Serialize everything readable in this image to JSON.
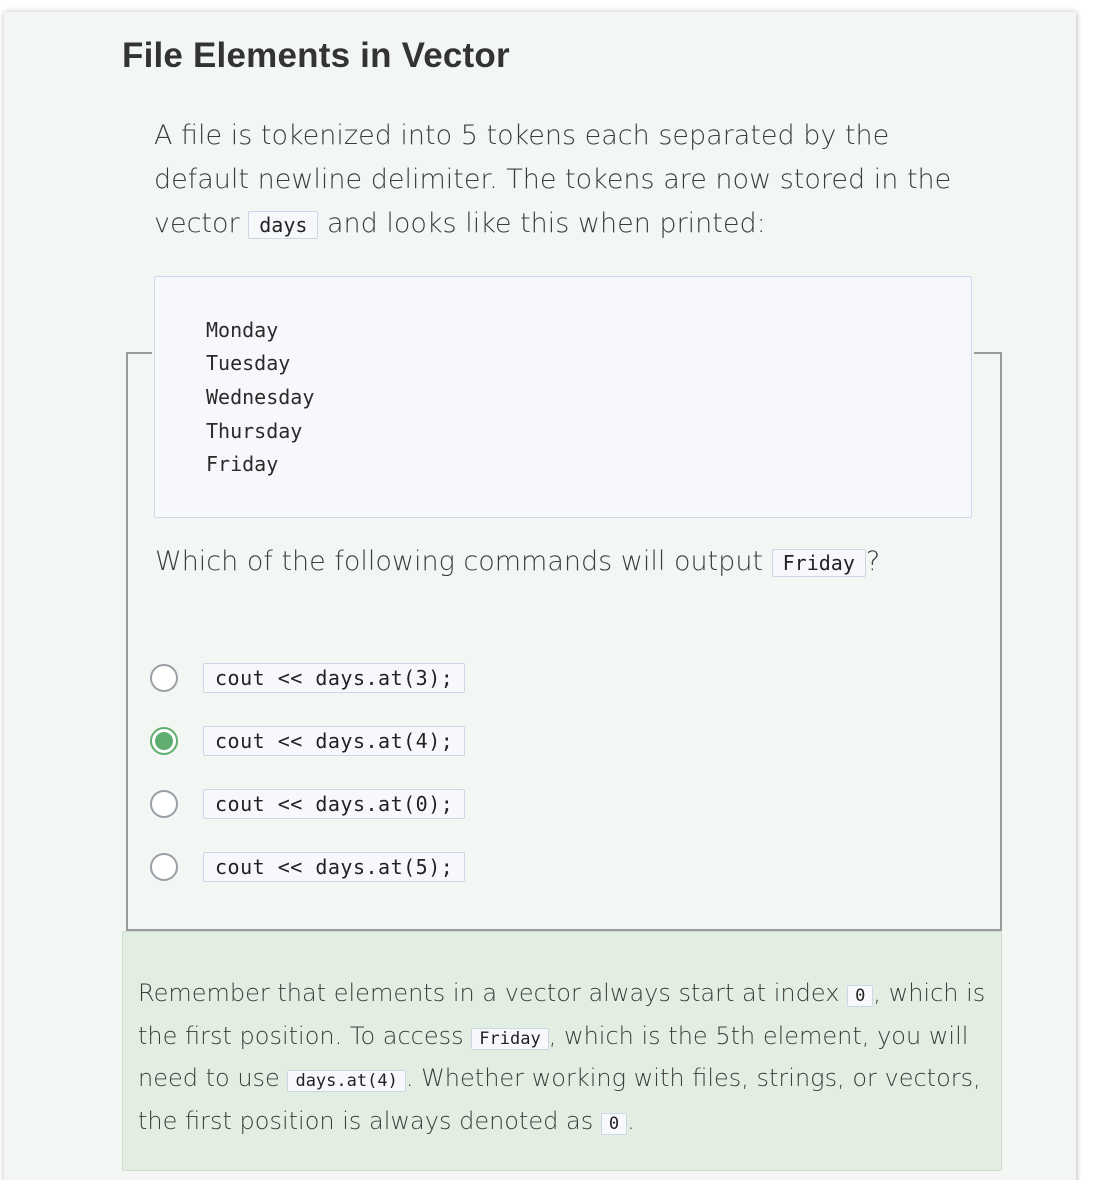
{
  "title": "File Elements in Vector",
  "intro": {
    "part1": "A file is tokenized into 5 tokens each separated by the default newline delimiter. The tokens are now stored in the vector",
    "code": "days",
    "part2": "and looks like this when printed:"
  },
  "output_lines": [
    "Monday",
    "Tuesday",
    "Wednesday",
    "Thursday",
    "Friday"
  ],
  "question": {
    "text": "Which of the following commands will output",
    "code": "Friday",
    "end": "?"
  },
  "options": [
    {
      "code": "cout << days.at(3);",
      "selected": false
    },
    {
      "code": "cout << days.at(4);",
      "selected": true
    },
    {
      "code": "cout << days.at(0);",
      "selected": false
    },
    {
      "code": "cout << days.at(5);",
      "selected": false
    }
  ],
  "feedback": {
    "t1": "Remember that elements in a vector always start at index",
    "c1": "0",
    "t2": ", which is the first position. To access",
    "c2": "Friday",
    "t3": ", which is the 5th element, you will need to use",
    "c3": "days.at(4)",
    "t4": ". Whether working with files, strings, or vectors, the first position is always denoted as",
    "c4": "0",
    "t5": "."
  },
  "colors": {
    "card_bg": "#f3f7f3",
    "feedback_bg": "#e3eee3",
    "selected_radio": "#5fae70",
    "code_border": "#cdd6e4"
  }
}
